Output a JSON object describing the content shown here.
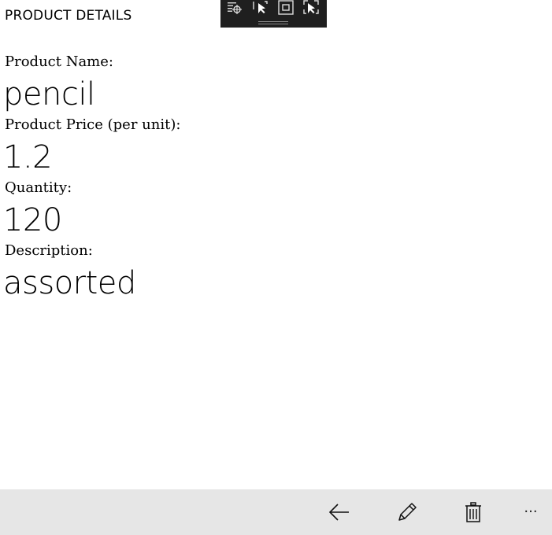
{
  "header": {
    "title": "PRODUCT DETAILS"
  },
  "dev_toolbar": {
    "tools": [
      "live-visual-tree-icon",
      "select-element-icon",
      "display-layout-adorners-icon",
      "track-focus-icon"
    ]
  },
  "fields": [
    {
      "label": "Product Name:",
      "value": "pencil"
    },
    {
      "label": "Product Price (per unit):",
      "value": "1.2"
    },
    {
      "label": "Quantity:",
      "value": "120"
    },
    {
      "label": "Description:",
      "value": "assorted"
    }
  ],
  "command_bar": {
    "buttons": [
      "back-arrow-icon",
      "edit-pencil-icon",
      "delete-trash-icon"
    ],
    "more_label": "···"
  },
  "colors": {
    "background": "#ffffff",
    "command_bar": "#e6e6e6",
    "dev_toolbar": "#1f1f1f",
    "text": "#000000"
  }
}
